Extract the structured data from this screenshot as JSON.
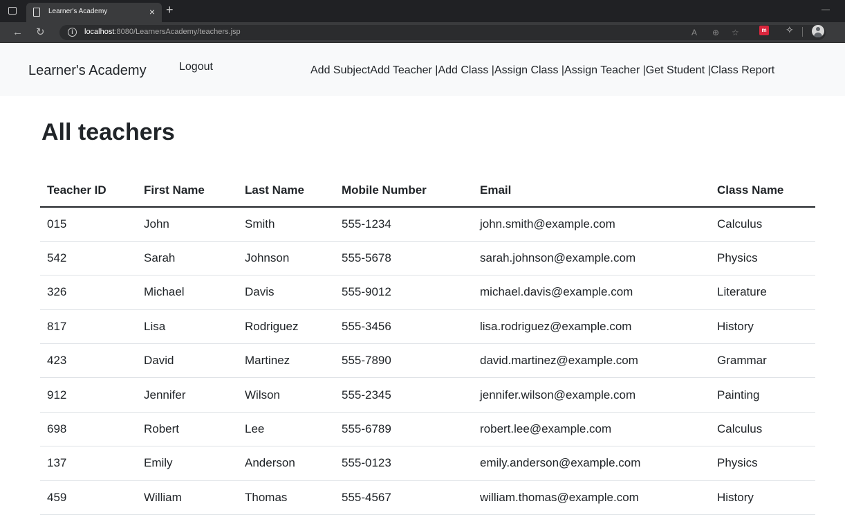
{
  "browser": {
    "tab_title": "Learner's Academy",
    "url_host": "localhost",
    "url_rest": ":8080/LearnersAcademy/teachers.jsp"
  },
  "navbar": {
    "brand": "Learner's Academy",
    "logout": "Logout",
    "links": [
      "Add Subject",
      "Add Teacher |",
      "Add Class |",
      "Assign Class |",
      "Assign Teacher |",
      "Get Student |",
      "Class Report"
    ]
  },
  "page": {
    "title": "All teachers"
  },
  "table": {
    "headers": [
      "Teacher ID",
      "First Name",
      "Last Name",
      "Mobile Number",
      "Email",
      "Class Name"
    ],
    "rows": [
      [
        "015",
        "John",
        "Smith",
        "555-1234",
        "john.smith@example.com",
        "Calculus"
      ],
      [
        "542",
        "Sarah",
        "Johnson",
        "555-5678",
        "sarah.johnson@example.com",
        "Physics"
      ],
      [
        "326",
        "Michael",
        "Davis",
        "555-9012",
        "michael.davis@example.com",
        "Literature"
      ],
      [
        "817",
        "Lisa",
        "Rodriguez",
        "555-3456",
        "lisa.rodriguez@example.com",
        "History"
      ],
      [
        "423",
        "David",
        "Martinez",
        "555-7890",
        "david.martinez@example.com",
        "Grammar"
      ],
      [
        "912",
        "Jennifer",
        "Wilson",
        "555-2345",
        "jennifer.wilson@example.com",
        "Painting"
      ],
      [
        "698",
        "Robert",
        "Lee",
        "555-6789",
        "robert.lee@example.com",
        "Calculus"
      ],
      [
        "137",
        "Emily",
        "Anderson",
        "555-0123",
        "emily.anderson@example.com",
        "Physics"
      ],
      [
        "459",
        "William",
        "Thomas",
        "555-4567",
        "william.thomas@example.com",
        "History"
      ]
    ]
  }
}
